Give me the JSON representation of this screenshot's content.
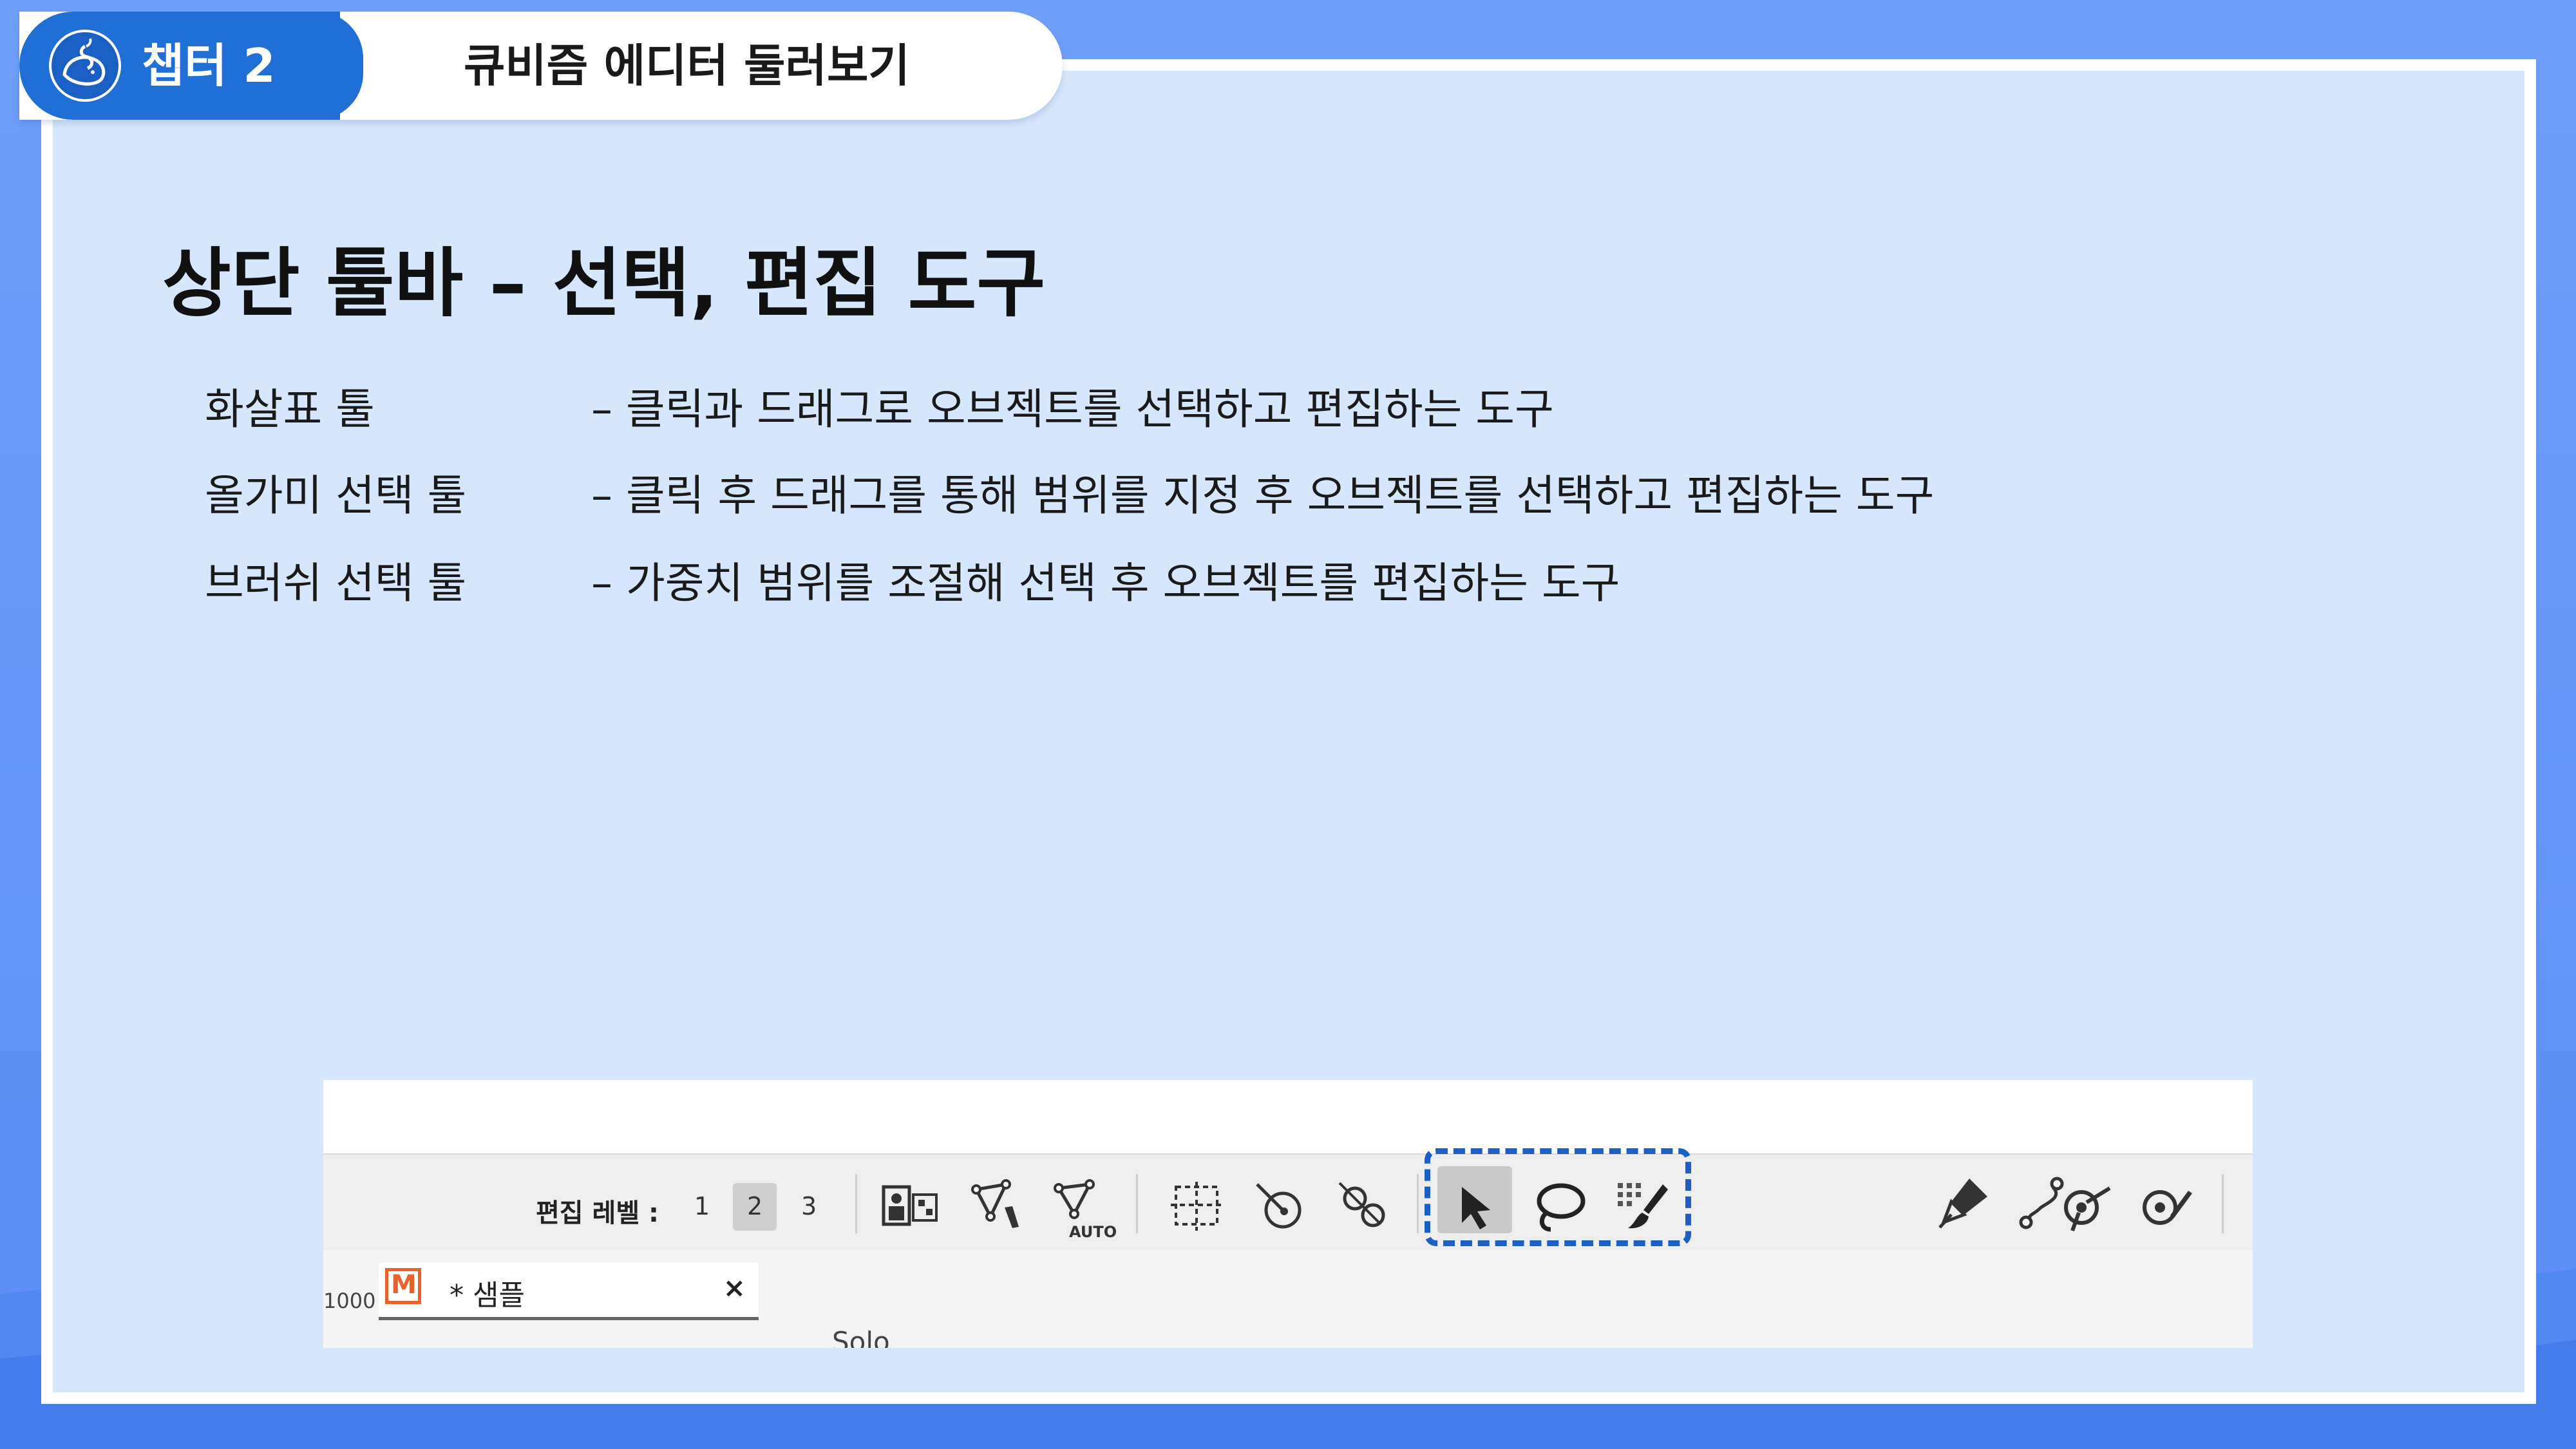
{
  "header": {
    "chapter_label": "챕터 2",
    "chapter_title": "큐비즘 에디터 둘러보기"
  },
  "main": {
    "heading": "상단 툴바 –  선택, 편집 도구",
    "tools": [
      {
        "name": "화살표 툴",
        "desc": "–  클릭과 드래그로 오브젝트를 선택하고 편집하는 도구"
      },
      {
        "name": "올가미 선택 툴",
        "desc": "–  클릭 후 드래그를 통해 범위를 지정 후 오브젝트를 선택하고 편집하는 도구"
      },
      {
        "name": "브러쉬 선택 툴",
        "desc": "–  가중치 범위를 조절해 선택 후 오브젝트를 편집하는 도구"
      }
    ]
  },
  "screenshot": {
    "edit_level_label": "편집 레벨 :",
    "levels": [
      "1",
      "2",
      "3"
    ],
    "selected_level": "2",
    "auto_label": "AUTO",
    "doc_tab_label": "* 샘플",
    "doc_tab_icon": "M",
    "close_label": "×",
    "ruler_value": "1000",
    "solo_label": "Solo"
  },
  "colors": {
    "accent": "#1f6fd6",
    "background": "#d6e7fd",
    "highlight_border": "#1a5fc4"
  }
}
